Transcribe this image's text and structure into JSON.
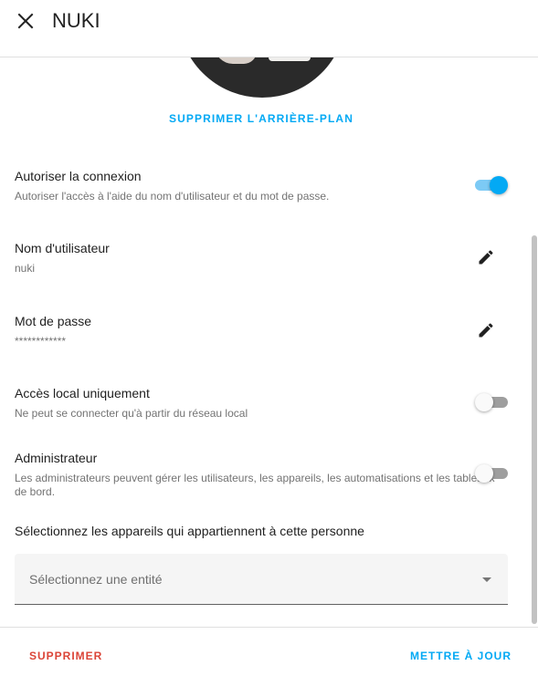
{
  "dialog": {
    "title": "NUKI"
  },
  "icons": {
    "close": "close-icon",
    "edit": "pencil-icon",
    "dropdown": "chevron-down-icon"
  },
  "picture": {
    "remove_background_label": "SUPPRIMER L'ARRIÈRE-PLAN"
  },
  "allow_login": {
    "title": "Autoriser la connexion",
    "description": "Autoriser l'accès à l'aide du nom d'utilisateur et du mot de passe.",
    "enabled": true
  },
  "username": {
    "title": "Nom d'utilisateur",
    "value": "nuki"
  },
  "password": {
    "title": "Mot de passe",
    "value": "************"
  },
  "local_only": {
    "title": "Accès local uniquement",
    "description": "Ne peut se connecter qu'à partir du réseau local",
    "enabled": false
  },
  "admin": {
    "title": "Administrateur",
    "description": "Les administrateurs peuvent gérer les utilisateurs, les appareils, les automatisations et les tableaux de bord.",
    "enabled": false
  },
  "devices": {
    "label": "Sélectionnez les appareils qui appartiennent à cette personne",
    "placeholder": "Sélectionnez une entité"
  },
  "footer": {
    "delete_label": "SUPPRIMER",
    "update_label": "METTRE À JOUR"
  },
  "colors": {
    "accent": "#03a9f4",
    "danger": "#db4437",
    "toggle_on_track": "#7ccaf5",
    "toggle_off_track": "#9e9e9e"
  }
}
